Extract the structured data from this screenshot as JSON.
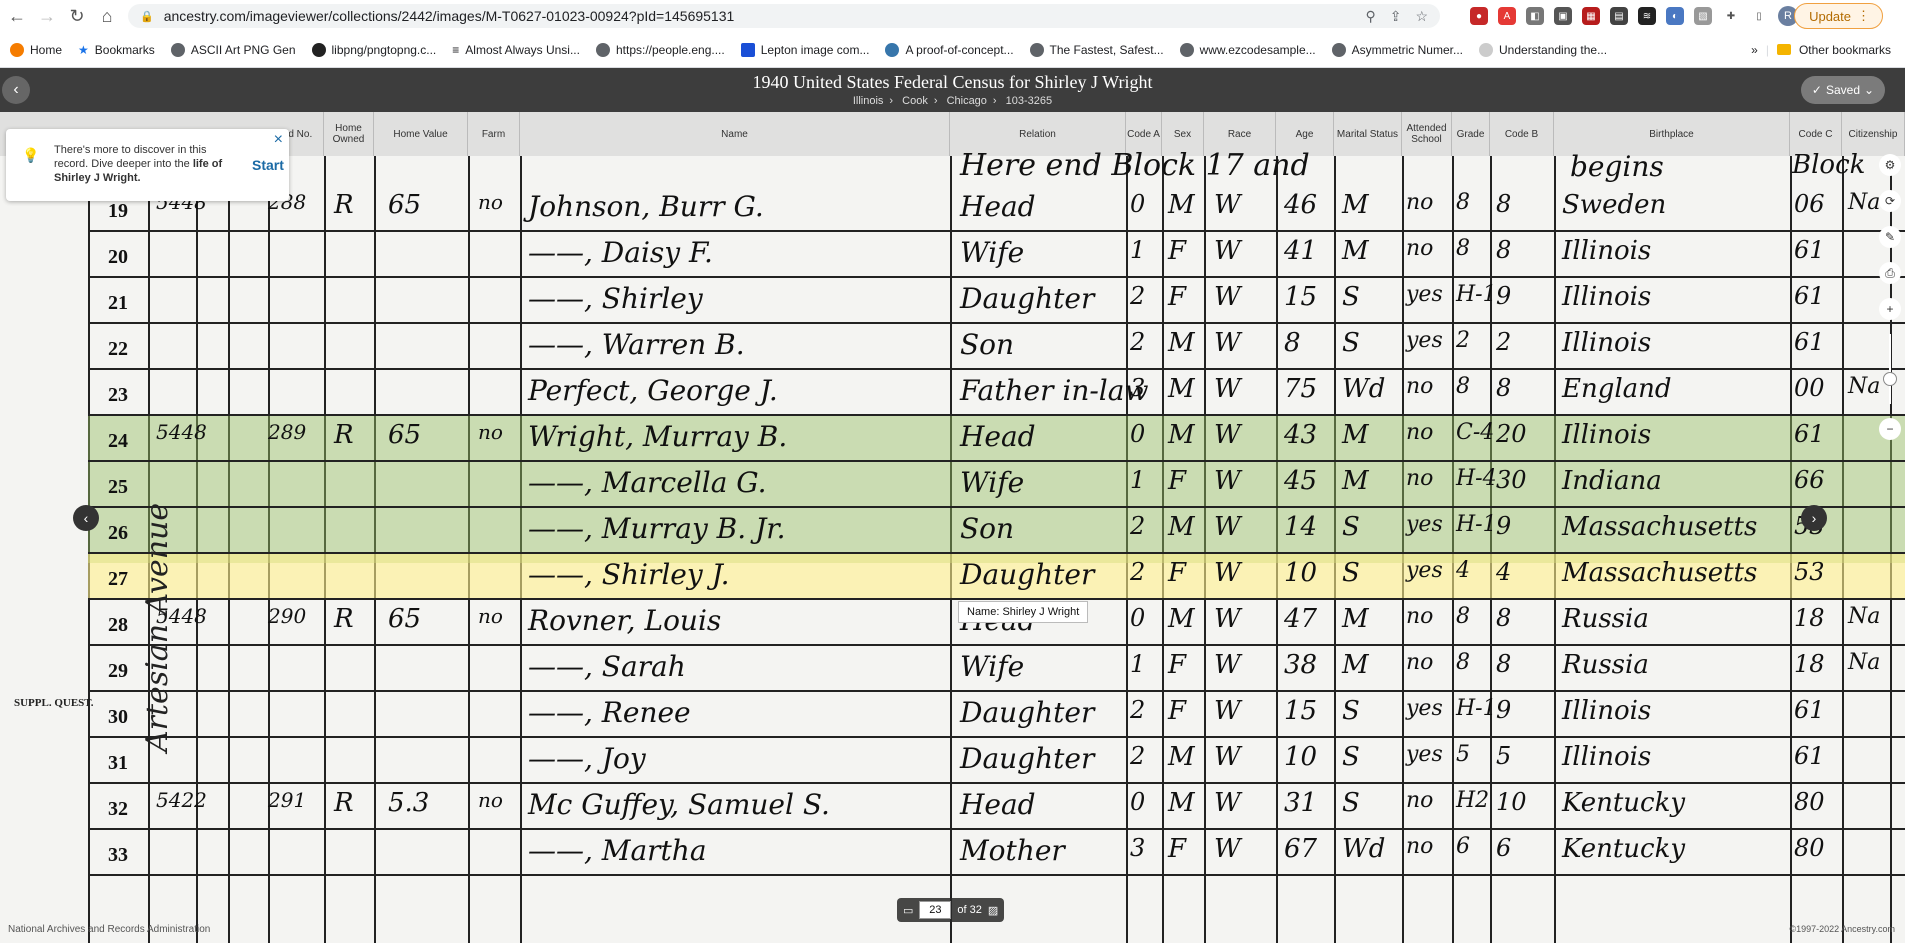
{
  "browser": {
    "url": "ancestry.com/imageviewer/collections/2442/images/M-T0627-01023-00924?pId=145695131",
    "update_label": "Update",
    "profile_initial": "R"
  },
  "bookmarks": {
    "items": [
      "Home",
      "Bookmarks",
      "ASCII Art PNG Gen",
      "libpng/pngtopng.c...",
      "Almost Always Unsi...",
      "https://people.eng....",
      "Lepton image com...",
      "A proof-of-concept...",
      "The Fastest, Safest...",
      "www.ezcodesample...",
      "Asymmetric Numer...",
      "Understanding the..."
    ],
    "more": "»",
    "other": "Other bookmarks"
  },
  "viewer": {
    "title": "1940 United States Federal Census for Shirley J Wright",
    "breadcrumb": [
      "Illinois",
      "Cook",
      "Chicago",
      "103-3265"
    ],
    "saved_label": "Saved"
  },
  "columns": [
    "ed No.",
    "Home Owned",
    "Home Value",
    "Farm",
    "Name",
    "Relation",
    "Code A",
    "Sex",
    "Race",
    "Age",
    "Marital Status",
    "Attended School",
    "Grade",
    "Code B",
    "Birthplace",
    "Code C",
    "Citizenship"
  ],
  "census": {
    "side_text": "Artesian Avenue",
    "suppl": "SUPPL. QUEST.",
    "top_row": {
      "name": "Here end Block 17 and",
      "birthplace": "begins",
      "codec": "Block"
    },
    "rows": [
      {
        "num": "19",
        "house": "5448",
        "fam": "288",
        "owned": "R",
        "value": "65",
        "farm": "no",
        "name": "Johnson, Burr G.",
        "relation": "Head",
        "codea": "0",
        "sex": "M",
        "race": "W",
        "age": "46",
        "marital": "M",
        "school": "no",
        "grade": "8",
        "codeb": "8",
        "birthplace": "Sweden",
        "codec": "06",
        "cit": "Na"
      },
      {
        "num": "20",
        "house": "",
        "fam": "",
        "owned": "",
        "value": "",
        "farm": "",
        "name": "——, Daisy F.",
        "relation": "Wife",
        "codea": "1",
        "sex": "F",
        "race": "W",
        "age": "41",
        "marital": "M",
        "school": "no",
        "grade": "8",
        "codeb": "8",
        "birthplace": "Illinois",
        "codec": "61",
        "cit": ""
      },
      {
        "num": "21",
        "house": "",
        "fam": "",
        "owned": "",
        "value": "",
        "farm": "",
        "name": "——, Shirley",
        "relation": "Daughter",
        "codea": "2",
        "sex": "F",
        "race": "W",
        "age": "15",
        "marital": "S",
        "school": "yes",
        "grade": "H-1",
        "codeb": "9",
        "birthplace": "Illinois",
        "codec": "61",
        "cit": ""
      },
      {
        "num": "22",
        "house": "",
        "fam": "",
        "owned": "",
        "value": "",
        "farm": "",
        "name": "——, Warren B.",
        "relation": "Son",
        "codea": "2",
        "sex": "M",
        "race": "W",
        "age": "8",
        "marital": "S",
        "school": "yes",
        "grade": "2",
        "codeb": "2",
        "birthplace": "Illinois",
        "codec": "61",
        "cit": ""
      },
      {
        "num": "23",
        "house": "",
        "fam": "",
        "owned": "",
        "value": "",
        "farm": "",
        "name": "Perfect, George J.",
        "relation": "Father in-law",
        "codea": "3",
        "sex": "M",
        "race": "W",
        "age": "75",
        "marital": "Wd",
        "school": "no",
        "grade": "8",
        "codeb": "8",
        "birthplace": "England",
        "codec": "00",
        "cit": "Na"
      },
      {
        "num": "24",
        "house": "5448",
        "fam": "289",
        "owned": "R",
        "value": "65",
        "farm": "no",
        "name": "Wright, Murray B.",
        "relation": "Head",
        "codea": "0",
        "sex": "M",
        "race": "W",
        "age": "43",
        "marital": "M",
        "school": "no",
        "grade": "C-4",
        "codeb": "20",
        "birthplace": "Illinois",
        "codec": "61",
        "cit": ""
      },
      {
        "num": "25",
        "house": "",
        "fam": "",
        "owned": "",
        "value": "",
        "farm": "",
        "name": "——, Marcella G.",
        "relation": "Wife",
        "codea": "1",
        "sex": "F",
        "race": "W",
        "age": "45",
        "marital": "M",
        "school": "no",
        "grade": "H-4",
        "codeb": "30",
        "birthplace": "Indiana",
        "codec": "66",
        "cit": ""
      },
      {
        "num": "26",
        "house": "",
        "fam": "",
        "owned": "",
        "value": "",
        "farm": "",
        "name": "——, Murray B. Jr.",
        "relation": "Son",
        "codea": "2",
        "sex": "M",
        "race": "W",
        "age": "14",
        "marital": "S",
        "school": "yes",
        "grade": "H-1",
        "codeb": "9",
        "birthplace": "Massachusetts",
        "codec": "53",
        "cit": ""
      },
      {
        "num": "27",
        "house": "",
        "fam": "",
        "owned": "",
        "value": "",
        "farm": "",
        "name": "——, Shirley J.",
        "relation": "Daughter",
        "codea": "2",
        "sex": "F",
        "race": "W",
        "age": "10",
        "marital": "S",
        "school": "yes",
        "grade": "4",
        "codeb": "4",
        "birthplace": "Massachusetts",
        "codec": "53",
        "cit": ""
      },
      {
        "num": "28",
        "house": "5448",
        "fam": "290",
        "owned": "R",
        "value": "65",
        "farm": "no",
        "name": "Rovner, Louis",
        "relation": "Head",
        "codea": "0",
        "sex": "M",
        "race": "W",
        "age": "47",
        "marital": "M",
        "school": "no",
        "grade": "8",
        "codeb": "8",
        "birthplace": "Russia",
        "codec": "18",
        "cit": "Na"
      },
      {
        "num": "29",
        "house": "",
        "fam": "",
        "owned": "",
        "value": "",
        "farm": "",
        "name": "——, Sarah",
        "relation": "Wife",
        "codea": "1",
        "sex": "F",
        "race": "W",
        "age": "38",
        "marital": "M",
        "school": "no",
        "grade": "8",
        "codeb": "8",
        "birthplace": "Russia",
        "codec": "18",
        "cit": "Na"
      },
      {
        "num": "30",
        "house": "",
        "fam": "",
        "owned": "",
        "value": "",
        "farm": "",
        "name": "——, Renee",
        "relation": "Daughter",
        "codea": "2",
        "sex": "F",
        "race": "W",
        "age": "15",
        "marital": "S",
        "school": "yes",
        "grade": "H-1",
        "codeb": "9",
        "birthplace": "Illinois",
        "codec": "61",
        "cit": ""
      },
      {
        "num": "31",
        "house": "",
        "fam": "",
        "owned": "",
        "value": "",
        "farm": "",
        "name": "——, Joy",
        "relation": "Daughter",
        "codea": "2",
        "sex": "M",
        "race": "W",
        "age": "10",
        "marital": "S",
        "school": "yes",
        "grade": "5",
        "codeb": "5",
        "birthplace": "Illinois",
        "codec": "61",
        "cit": ""
      },
      {
        "num": "32",
        "house": "5422",
        "fam": "291",
        "owned": "R",
        "value": "5.3",
        "farm": "no",
        "name": "Mc Guffey, Samuel S.",
        "relation": "Head",
        "codea": "0",
        "sex": "M",
        "race": "W",
        "age": "31",
        "marital": "S",
        "school": "no",
        "grade": "H2",
        "codeb": "10",
        "birthplace": "Kentucky",
        "codec": "80",
        "cit": ""
      },
      {
        "num": "33",
        "house": "",
        "fam": "",
        "owned": "",
        "value": "",
        "farm": "",
        "name": "——, Martha",
        "relation": "Mother",
        "codea": "3",
        "sex": "F",
        "race": "W",
        "age": "67",
        "marital": "Wd",
        "school": "no",
        "grade": "6",
        "codeb": "6",
        "birthplace": "Kentucky",
        "codec": "80",
        "cit": ""
      }
    ]
  },
  "discover": {
    "msg_pre": "There's more to discover in this record. Dive deeper into the ",
    "msg_bold": "life of Shirley J Wright.",
    "start": "Start",
    "close": "×"
  },
  "tooltip": "Name: Shirley J Wright",
  "pager": {
    "current": "23",
    "of": "of 32"
  },
  "footer": {
    "left": "National Archives and Records Administration",
    "right": "©1997-2022 Ancestry.com"
  }
}
